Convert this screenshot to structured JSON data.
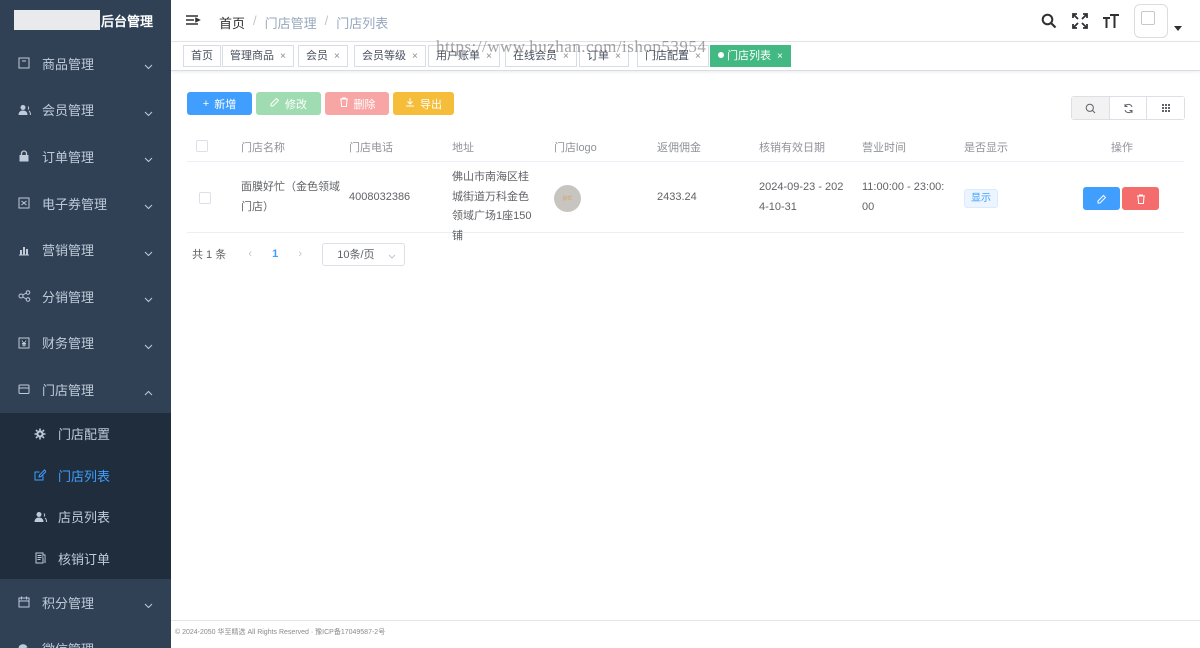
{
  "app": {
    "title": "后台管理"
  },
  "sidebar": {
    "menus": [
      {
        "label": "商品管理",
        "icon": "goods-icon"
      },
      {
        "label": "会员管理",
        "icon": "member-icon"
      },
      {
        "label": "订单管理",
        "icon": "lock-icon"
      },
      {
        "label": "电子券管理",
        "icon": "coupon-icon"
      },
      {
        "label": "营销管理",
        "icon": "chart-icon"
      },
      {
        "label": "分销管理",
        "icon": "share-icon"
      },
      {
        "label": "财务管理",
        "icon": "finance-icon"
      },
      {
        "label": "门店管理",
        "icon": "store-icon",
        "expanded": true
      }
    ],
    "submenu": [
      {
        "label": "门店配置",
        "icon": "gear-icon"
      },
      {
        "label": "门店列表",
        "icon": "edit-icon",
        "active": true
      },
      {
        "label": "店员列表",
        "icon": "user-icon"
      },
      {
        "label": "核销订单",
        "icon": "doc-icon"
      }
    ],
    "menus_after": [
      {
        "label": "积分管理",
        "icon": "calendar-icon"
      },
      {
        "label": "微信管理",
        "icon": "wechat-icon"
      }
    ]
  },
  "breadcrumb": [
    "首页",
    "门店管理",
    "门店列表"
  ],
  "tags": [
    {
      "label": "首页",
      "closable": false
    },
    {
      "label": "管理商品",
      "closable": true
    },
    {
      "label": "会员",
      "closable": true
    },
    {
      "label": "会员等级",
      "closable": true
    },
    {
      "label": "用户账单",
      "closable": true
    },
    {
      "label": "在线会员",
      "closable": true
    },
    {
      "label": "订单",
      "closable": true
    },
    {
      "label": "门店配置",
      "closable": true
    },
    {
      "label": "门店列表",
      "closable": true,
      "active": true
    }
  ],
  "close_glyph": "×",
  "watermark": "https://www.huzhan.com/ishop53954",
  "toolbar": {
    "add": "新增",
    "edit": "修改",
    "delete": "删除",
    "export": "导出"
  },
  "table": {
    "headers": [
      "门店名称",
      "门店电话",
      "地址",
      "门店logo",
      "返佣佣金",
      "核销有效日期",
      "营业时间",
      "是否显示",
      "操作"
    ],
    "rows": [
      {
        "name": "面膜好忙（金色领域门店）",
        "phone": "4008032386",
        "address": "佛山市南海区桂城街道万科金色领域广场1座150铺",
        "logo_text": "好忙",
        "commission": "2433.24",
        "valid_date": "2024-09-23 - 2024-10-31",
        "hours": "11:00:00 - 23:00:00",
        "visible": "显示"
      }
    ]
  },
  "pagination": {
    "total": "共 1 条",
    "prev": "‹",
    "current": "1",
    "next": "›",
    "page_size": "10条/页"
  },
  "footer": "© 2024-2050 华至精选 All Rights Reserved · 豫ICP备17049587-2号",
  "colors": {
    "sidebar_bg": "#304156",
    "submenu_bg": "#1f2d3d",
    "primary": "#409eff",
    "success": "#42b983",
    "danger": "#f56c6c",
    "warning": "#f5bd3a"
  }
}
